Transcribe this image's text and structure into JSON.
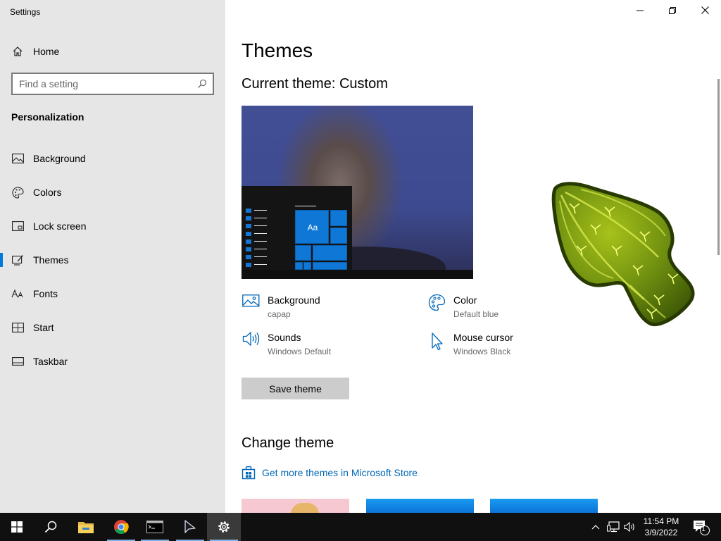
{
  "window": {
    "title": "Settings",
    "controls": [
      "minimize-icon",
      "restore-icon",
      "close-icon"
    ]
  },
  "sidebar": {
    "home_label": "Home",
    "search_placeholder": "Find a setting",
    "section": "Personalization",
    "items": [
      {
        "label": "Background",
        "icon": "background-icon",
        "active": false
      },
      {
        "label": "Colors",
        "icon": "palette-icon",
        "active": false
      },
      {
        "label": "Lock screen",
        "icon": "lock-screen-icon",
        "active": false
      },
      {
        "label": "Themes",
        "icon": "themes-icon",
        "active": true
      },
      {
        "label": "Fonts",
        "icon": "fonts-icon",
        "active": false
      },
      {
        "label": "Start",
        "icon": "start-icon",
        "active": false
      },
      {
        "label": "Taskbar",
        "icon": "taskbar-icon",
        "active": false
      }
    ]
  },
  "main": {
    "title": "Themes",
    "current_theme": "Current theme: Custom",
    "preview_tile_label": "Aa",
    "properties": {
      "background": {
        "label": "Background",
        "value": "capap"
      },
      "color": {
        "label": "Color",
        "value": "Default blue"
      },
      "sounds": {
        "label": "Sounds",
        "value": "Windows Default"
      },
      "mouse_cursor": {
        "label": "Mouse cursor",
        "value": "Windows Black"
      }
    },
    "save_button": "Save theme",
    "change_theme_heading": "Change theme",
    "store_link": "Get more themes in Microsoft Store"
  },
  "taskbar": {
    "apps": [
      "start-icon",
      "search-icon",
      "file-explorer-icon",
      "chrome-icon",
      "terminal-icon",
      "cursor-app-icon",
      "settings-icon"
    ],
    "clock_time": "11:54 PM",
    "clock_date": "3/9/2022",
    "notification_count": "1"
  },
  "colors": {
    "accent": "#0078d7",
    "link": "#0067b8",
    "sidebar_bg": "#e6e6e6",
    "taskbar_bg": "#101010"
  }
}
